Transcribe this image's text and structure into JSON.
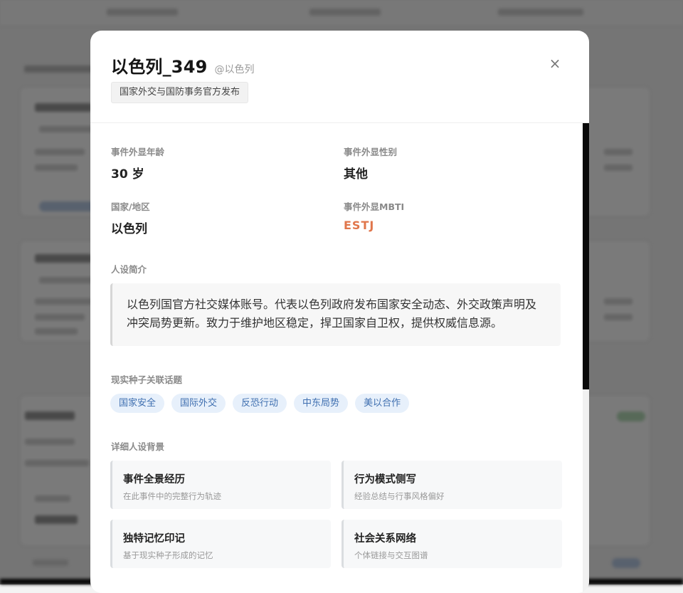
{
  "persona": {
    "name": "以色列_349",
    "handle": "@以色列",
    "tag": "国家外交与国防事务官方发布"
  },
  "close_symbol": "×",
  "attributes": [
    {
      "label": "事件外显年龄",
      "value": "30 岁"
    },
    {
      "label": "事件外显性别",
      "value": "其他"
    },
    {
      "label": "国家/地区",
      "value": "以色列"
    },
    {
      "label": "事件外显MBTI",
      "value": "ESTJ"
    }
  ],
  "bio": {
    "label": "人设简介",
    "text": "以色列国官方社交媒体账号。代表以色列政府发布国家安全动态、外交政策声明及冲突局势更新。致力于维护地区稳定，捍卫国家自卫权，提供权威信息源。"
  },
  "topics": {
    "label": "现实种子关联话题",
    "items": [
      "国家安全",
      "国际外交",
      "反恐行动",
      "中东局势",
      "美以合作"
    ]
  },
  "details": {
    "label": "详细人设背景",
    "cards": [
      {
        "title": "事件全景经历",
        "subtitle": "在此事件中的完整行为轨迹"
      },
      {
        "title": "行为模式侧写",
        "subtitle": "经验总结与行事风格偏好"
      },
      {
        "title": "独特记忆印记",
        "subtitle": "基于现实种子形成的记忆"
      },
      {
        "title": "社会关系网络",
        "subtitle": "个体链接与交互图谱"
      }
    ]
  },
  "colors": {
    "mbti_accent": "#e0764b",
    "topic_text": "#3f6fb0",
    "topic_bg": "#e7f0fb"
  }
}
